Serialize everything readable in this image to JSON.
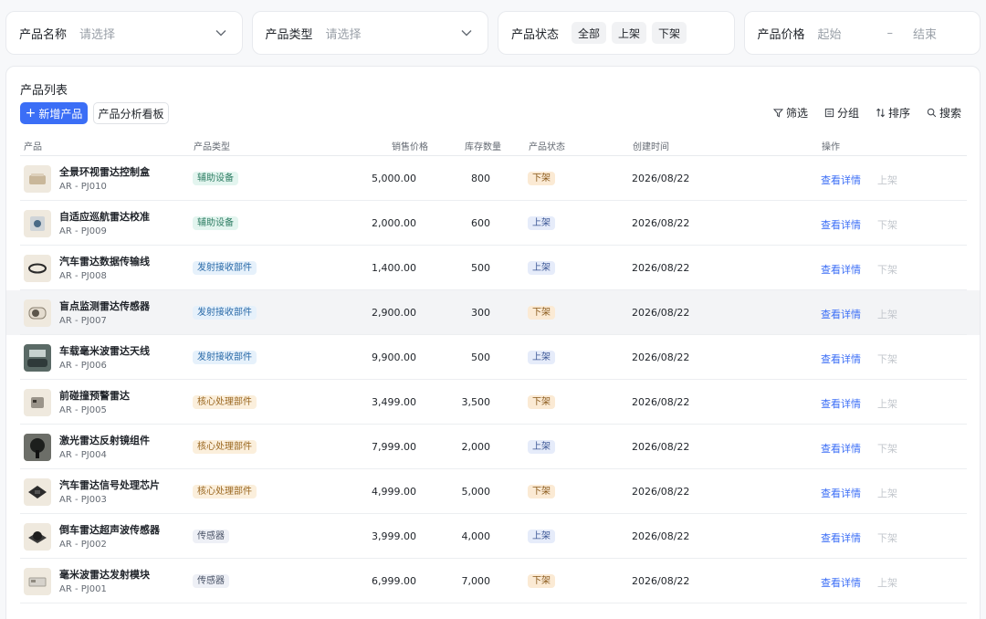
{
  "filters": {
    "name_label": "产品名称",
    "name_placeholder": "请选择",
    "type_label": "产品类型",
    "type_placeholder": "请选择",
    "status_label": "产品状态",
    "status_options": [
      "全部",
      "上架",
      "下架"
    ],
    "price_label": "产品价格",
    "price_start": "起始",
    "price_dash": "–",
    "price_end": "结束"
  },
  "panel": {
    "title": "产品列表",
    "add_button": "新增产品",
    "analysis_button": "产品分析看板",
    "tools": {
      "filter": "筛选",
      "group": "分组",
      "sort": "排序",
      "search": "搜索"
    }
  },
  "table": {
    "columns": {
      "product": "产品",
      "type": "产品类型",
      "price": "销售价格",
      "stock": "库存数量",
      "status": "产品状态",
      "created": "创建时间",
      "actions": "操作"
    },
    "rows": [
      {
        "name": "全景环视雷达控制盒",
        "code": "AR - PJ010",
        "type": "辅助设备",
        "type_kind": "aux",
        "price": "5,000.00",
        "stock": "800",
        "status": "下架",
        "status_kind": "off",
        "date": "2026/08/22",
        "detail": "查看详情",
        "toggle": "上架",
        "thumb": "box-icon"
      },
      {
        "name": "自适应巡航雷达校准",
        "code": "AR - PJ009",
        "type": "辅助设备",
        "type_kind": "aux",
        "price": "2,000.00",
        "stock": "600",
        "status": "上架",
        "status_kind": "on",
        "date": "2026/08/22",
        "detail": "查看详情",
        "toggle": "下架",
        "thumb": "calibrator-icon"
      },
      {
        "name": "汽车雷达数据传输线",
        "code": "AR - PJ008",
        "type": "发射接收部件",
        "type_kind": "tx",
        "price": "1,400.00",
        "stock": "500",
        "status": "上架",
        "status_kind": "on",
        "date": "2026/08/22",
        "detail": "查看详情",
        "toggle": "下架",
        "thumb": "cable-icon"
      },
      {
        "name": "盲点监测雷达传感器",
        "code": "AR - PJ007",
        "type": "发射接收部件",
        "type_kind": "tx",
        "price": "2,900.00",
        "stock": "300",
        "status": "下架",
        "status_kind": "off",
        "date": "2026/08/22",
        "detail": "查看详情",
        "toggle": "上架",
        "thumb": "sensor-icon"
      },
      {
        "name": "车载毫米波雷达天线",
        "code": "AR - PJ006",
        "type": "发射接收部件",
        "type_kind": "tx",
        "price": "9,900.00",
        "stock": "500",
        "status": "上架",
        "status_kind": "on",
        "date": "2026/08/22",
        "detail": "查看详情",
        "toggle": "下架",
        "thumb": "antenna-icon"
      },
      {
        "name": "前碰撞预警雷达",
        "code": "AR - PJ005",
        "type": "核心处理部件",
        "type_kind": "core",
        "price": "3,499.00",
        "stock": "3,500",
        "status": "下架",
        "status_kind": "off",
        "date": "2026/08/22",
        "detail": "查看详情",
        "toggle": "上架",
        "thumb": "radar-icon"
      },
      {
        "name": "激光雷达反射镜组件",
        "code": "AR - PJ004",
        "type": "核心处理部件",
        "type_kind": "core",
        "price": "7,999.00",
        "stock": "2,000",
        "status": "上架",
        "status_kind": "on",
        "date": "2026/08/22",
        "detail": "查看详情",
        "toggle": "下架",
        "thumb": "mirror-icon"
      },
      {
        "name": "汽车雷达信号处理芯片",
        "code": "AR - PJ003",
        "type": "核心处理部件",
        "type_kind": "core",
        "price": "4,999.00",
        "stock": "5,000",
        "status": "下架",
        "status_kind": "off",
        "date": "2026/08/22",
        "detail": "查看详情",
        "toggle": "上架",
        "thumb": "chip-icon"
      },
      {
        "name": "倒车雷达超声波传感器",
        "code": "AR - PJ002",
        "type": "传感器",
        "type_kind": "sensor",
        "price": "3,999.00",
        "stock": "4,000",
        "status": "上架",
        "status_kind": "on",
        "date": "2026/08/22",
        "detail": "查看详情",
        "toggle": "下架",
        "thumb": "ultrasonic-icon"
      },
      {
        "name": "毫米波雷达发射模块",
        "code": "AR - PJ001",
        "type": "传感器",
        "type_kind": "sensor",
        "price": "6,999.00",
        "stock": "7,000",
        "status": "下架",
        "status_kind": "off",
        "date": "2026/08/22",
        "detail": "查看详情",
        "toggle": "上架",
        "thumb": "module-icon"
      }
    ]
  }
}
